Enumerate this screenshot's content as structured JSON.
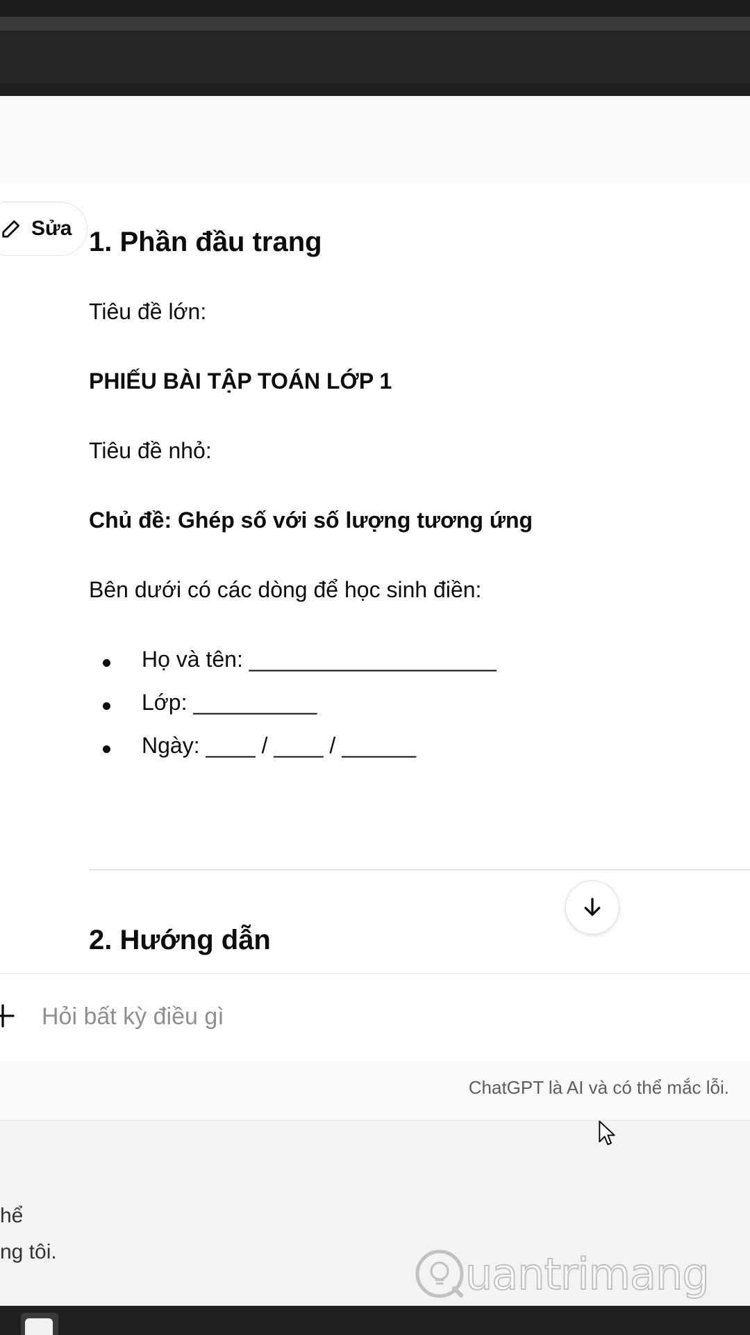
{
  "edit_button": {
    "label": "Sửa"
  },
  "article": {
    "section1_heading": "1. Phần đầu trang",
    "big_title_label": "Tiêu đề lớn:",
    "big_title_value": "PHIẾU BÀI TẬP TOÁN LỚP 1",
    "small_title_label": "Tiêu đề nhỏ:",
    "small_title_value": "Chủ đề: Ghép số với số lượng tương ứng",
    "fill_lines_intro": "Bên dưới có các dòng để học sinh điền:",
    "fill_items": [
      "Họ và tên: ____________________",
      "Lớp: __________",
      "Ngày: ____ / ____ / ______"
    ],
    "section2_heading": "2. Hướng dẫn"
  },
  "composer": {
    "placeholder": "Hỏi bất kỳ điều gì"
  },
  "footer": {
    "disclaimer": "ChatGPT là AI và có thể mắc lỗi."
  },
  "background_text": {
    "line1": "hể",
    "line2": "ng tôi."
  },
  "watermark": {
    "text": "uantrimang"
  },
  "icons": {
    "edit": "pencil-icon",
    "scroll": "arrow-down-icon",
    "attach": "plus-icon",
    "cursor": "mouse-cursor-icon"
  }
}
